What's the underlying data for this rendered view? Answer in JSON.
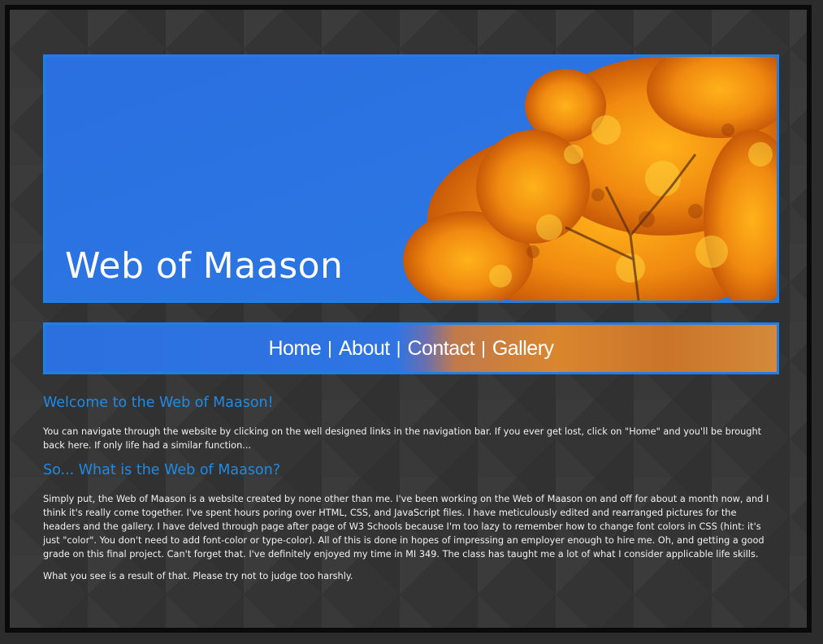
{
  "header": {
    "site_title": "Web of Maason"
  },
  "nav": {
    "items": [
      {
        "label": "Home"
      },
      {
        "label": "About"
      },
      {
        "label": "Contact"
      },
      {
        "label": "Gallery"
      }
    ],
    "separator": "|"
  },
  "main": {
    "sections": [
      {
        "heading": "Welcome to the Web of Maason!",
        "paragraphs": [
          "You can navigate through the website by clicking on the well designed links in the navigation bar. If you ever get lost, click on \"Home\" and you'll be brought back here. If only life had a similar function..."
        ]
      },
      {
        "heading": "So... What is the Web of Maason?",
        "paragraphs": [
          "Simply put, the Web of Maason is a website created by none other than me. I've been working on the Web of Maason on and off for about a month now, and I think it's really come together. I've spent hours poring over HTML, CSS, and JavaScript files. I have meticulously edited and rearranged pictures for the headers and the gallery. I have delved through page after page of W3 Schools because I'm too lazy to remember how to change font colors in CSS (hint: it's just \"color\". You don't need to add font-color or type-color). All of this is done in hopes of impressing an employer enough to hire me. Oh, and getting a good grade on this final project. Can't forget that. I've definitely enjoyed my time in MI 349. The class has taught me a lot of what I consider applicable life skills.",
          "What you see is a result of that. Please try not to judge too harshly."
        ]
      }
    ]
  },
  "colors": {
    "accent": "#1e8be6",
    "background": "#343434",
    "frame": "#0a0a0a",
    "sky": "#2b6fe0",
    "foliage": "#f08a10"
  }
}
